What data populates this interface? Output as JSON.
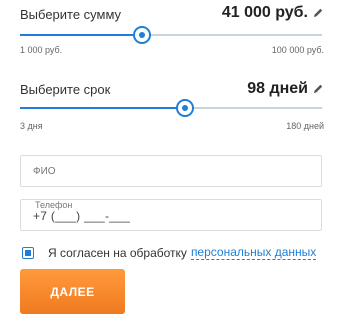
{
  "amount": {
    "label": "Выберите сумму",
    "value": "41 000 руб.",
    "min_label": "1 000 руб.",
    "max_label": "100 000 руб.",
    "position_fraction": 0.404
  },
  "term": {
    "label": "Выберите срок",
    "value": "98 дней",
    "min_label": "3 дня",
    "max_label": "180 дней",
    "position_fraction": 0.548
  },
  "form": {
    "name_placeholder": "ФИО",
    "phone_label": "Телефон",
    "phone_value": "+7 (___) ___-___"
  },
  "consent": {
    "text": "Я согласен на обработку",
    "link_text": "персональных данных",
    "checked": true
  },
  "submit_label": "ДАЛЕЕ",
  "colors": {
    "accent": "#1f7fd6",
    "button": "#f07a1e"
  }
}
